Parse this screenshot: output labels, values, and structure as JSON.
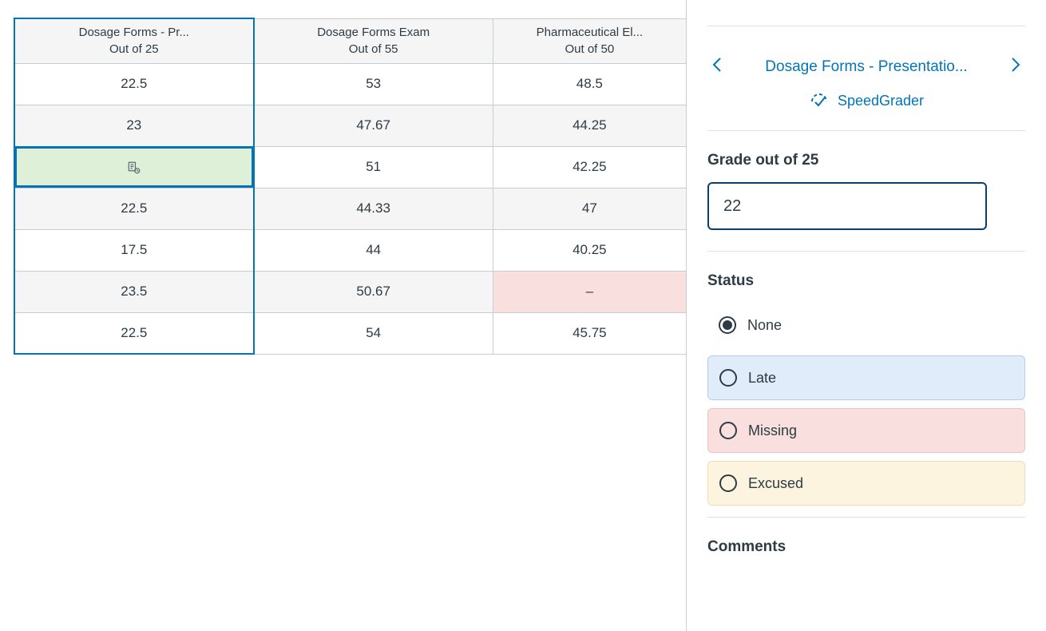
{
  "columns": [
    {
      "title": "Dosage Forms - Pr...",
      "sub": "Out of 25"
    },
    {
      "title": "Dosage Forms Exam",
      "sub": "Out of 55"
    },
    {
      "title": "Pharmaceutical El...",
      "sub": "Out of 50"
    }
  ],
  "rows": [
    {
      "c1": "22.5",
      "c2": "53",
      "c3": "48.5"
    },
    {
      "c1": "23",
      "c2": "47.67",
      "c3": "44.25"
    },
    {
      "c1": "",
      "c2": "51",
      "c3": "42.25"
    },
    {
      "c1": "22.5",
      "c2": "44.33",
      "c3": "47"
    },
    {
      "c1": "17.5",
      "c2": "44",
      "c3": "40.25"
    },
    {
      "c1": "23.5",
      "c2": "50.67",
      "c3": "–"
    },
    {
      "c1": "22.5",
      "c2": "54",
      "c3": "45.75"
    }
  ],
  "sidebar": {
    "assignment_nav": "Dosage Forms - Presentatio...",
    "speedgrader": "SpeedGrader",
    "grade_label": "Grade out of 25",
    "grade_value": "22",
    "status_head": "Status",
    "status": {
      "none": "None",
      "late": "Late",
      "missing": "Missing",
      "excused": "Excused",
      "selected": "none"
    },
    "comments_head": "Comments"
  }
}
